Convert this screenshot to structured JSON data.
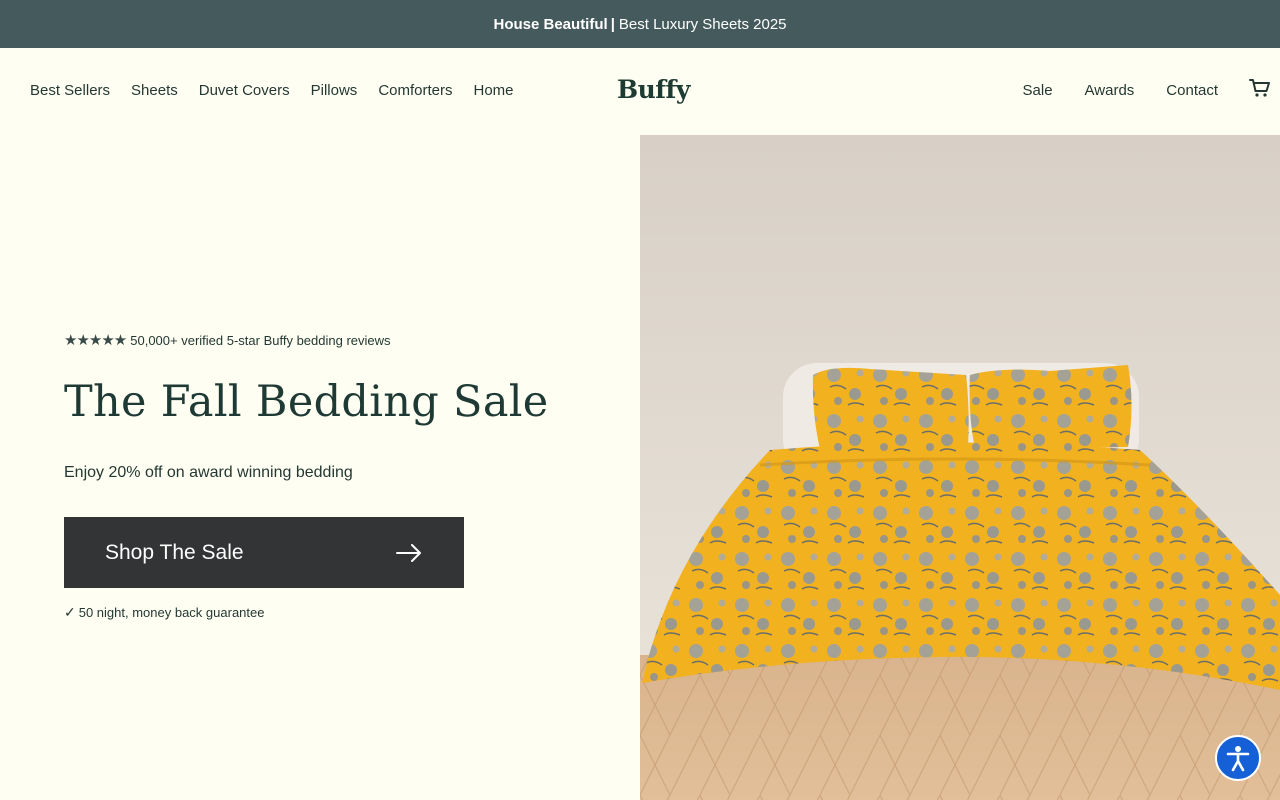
{
  "announcement": {
    "bold": "House Beautiful",
    "separator": "|",
    "text": "Best Luxury Sheets 2025"
  },
  "nav": {
    "left": [
      "Best Sellers",
      "Sheets",
      "Duvet Covers",
      "Pillows",
      "Comforters",
      "Home"
    ],
    "logo": "Buffy",
    "right": [
      "Sale",
      "Awards",
      "Contact"
    ],
    "cart_icon": "cart-icon"
  },
  "hero": {
    "rating_stars": 5,
    "reviews": "50,000+ verified 5-star Buffy bedding reviews",
    "headline": "The Fall Bedding Sale",
    "subline": "Enjoy 20% off on award winning bedding",
    "cta_label": "Shop The Sale",
    "guarantee": "50 night, money back guarantee"
  },
  "colors": {
    "background": "#fefff2",
    "announcement_bg": "#455a5c",
    "cta_bg": "#333435",
    "text": "#243833",
    "duvet": "#f4b21e",
    "accessibility": "#1560d6"
  },
  "accessibility_icon": "accessibility-icon"
}
